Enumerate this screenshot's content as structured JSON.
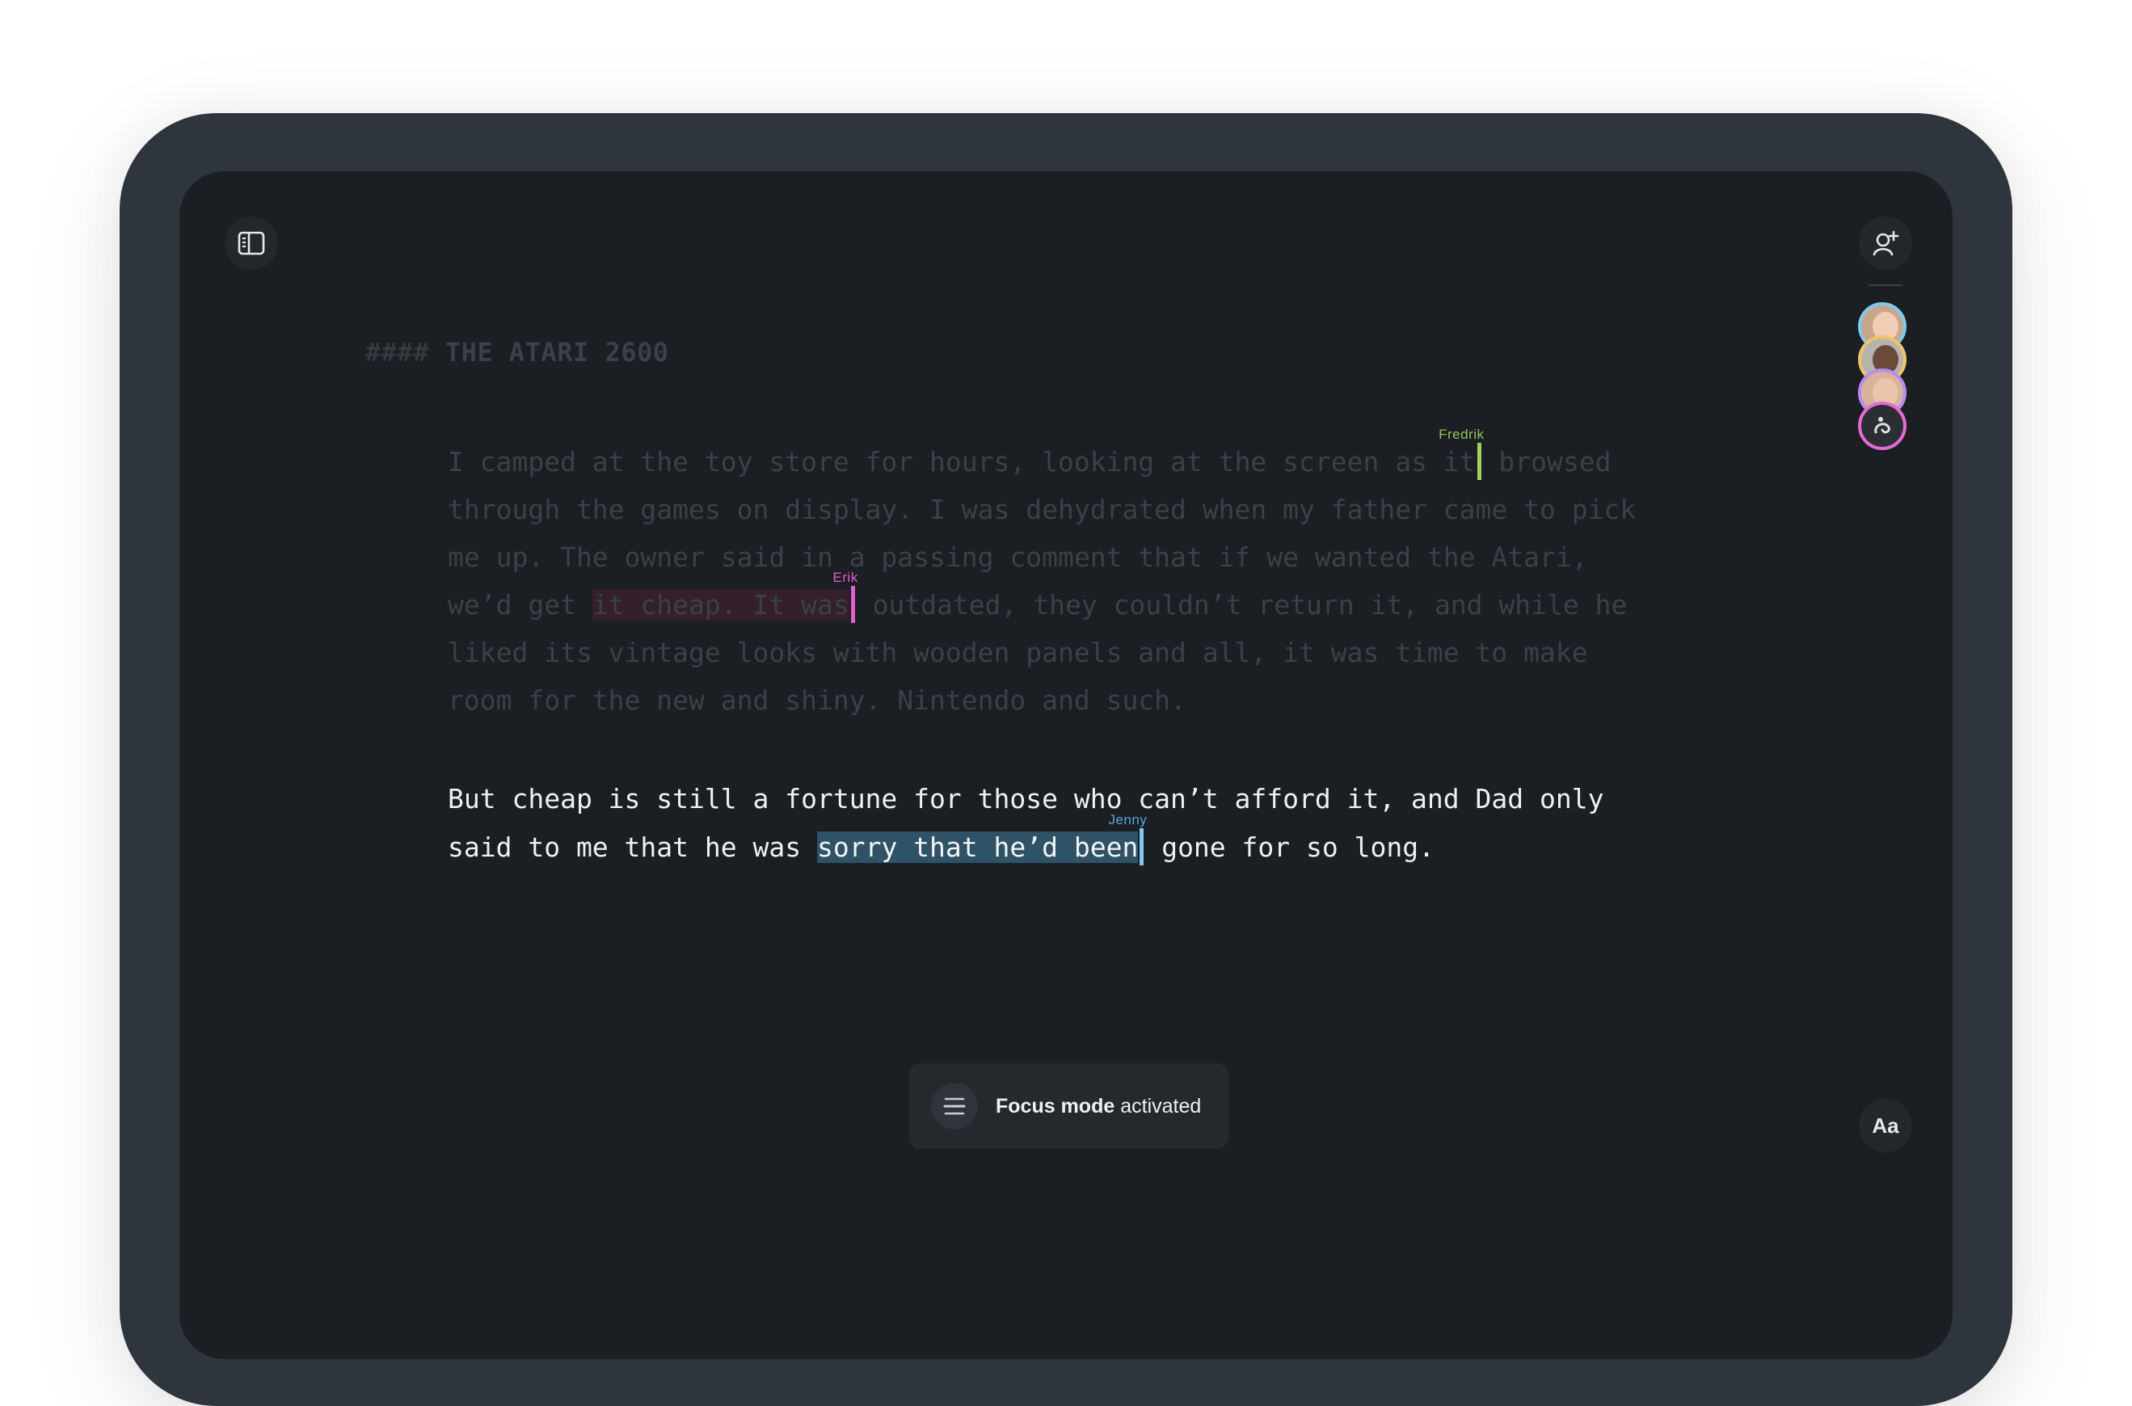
{
  "toolbar": {
    "sidebar_icon": "sidebar-panel-icon",
    "invite_icon": "add-user-icon",
    "font_label": "Aa"
  },
  "collaborators": [
    {
      "name": "avatar-blonde-woman",
      "ring": "#7ccbf0"
    },
    {
      "name": "avatar-bearded-man",
      "ring": "#f1c46a"
    },
    {
      "name": "avatar-brunette-woman",
      "ring": "#b78cf2"
    },
    {
      "name": "avatar-stylized-logo",
      "ring": "#e46ad7"
    }
  ],
  "document": {
    "heading_hashes": "####",
    "heading_text": "THE ATARI 2600",
    "para1": {
      "t1": "I camped at the toy store for hours, looking at the screen as it",
      "t2": " browsed\nthrough the games on display. I was dehydrated when my father came to pick\nme up. The owner said in a passing comment that if we wanted the Atari,\nwe’d get ",
      "erik_selection": "it cheap. It was",
      "t3": " outdated, they couldn’t return it, and while he\nliked its vintage looks with wooden panels and all, it was time to make\nroom for the new and shiny. Nintendo and such."
    },
    "para2": {
      "t1": "But cheap is still a fortune for those who can’t afford it, and Dad only\nsaid to me that he was ",
      "jenny_selection": "sorry that he’d been",
      "t2": " gone for so long."
    }
  },
  "cursors": {
    "fredrik": {
      "label": "Fredrik",
      "color": "#a2d162"
    },
    "erik": {
      "label": "Erik",
      "color": "#e25dcf"
    },
    "jenny": {
      "label": "Jenny",
      "color": "#7fc8ef"
    }
  },
  "toast": {
    "icon": "focus-lines-icon",
    "bold": "Focus mode",
    "rest": "activated"
  }
}
